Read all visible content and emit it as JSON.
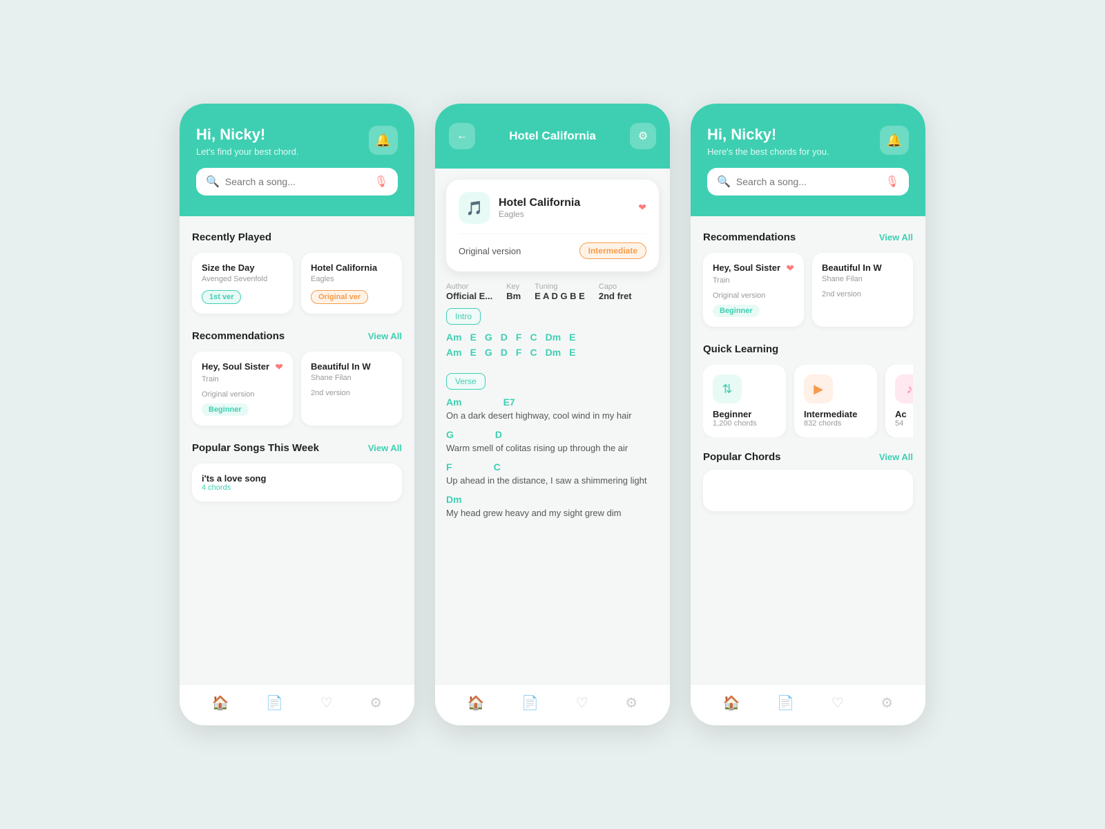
{
  "screen1": {
    "header": {
      "greeting": "Hi, Nicky!",
      "subtitle": "Let's find your best chord.",
      "notif_icon": "🔔"
    },
    "search": {
      "placeholder": "Search a song..."
    },
    "recently_played": {
      "title": "Recently Played",
      "songs": [
        {
          "name": "Size the Day",
          "artist": "Avenged Sevenfold",
          "badge": "1st ver",
          "badge_type": "green"
        },
        {
          "name": "Hotel California",
          "artist": "Eagles",
          "badge": "Original ver",
          "badge_type": "orange"
        }
      ]
    },
    "recommendations": {
      "title": "Recommendations",
      "view_all": "View All",
      "songs": [
        {
          "name": "Hey, Soul Sister",
          "artist": "Train",
          "version": "Original version",
          "badge": "Beginner",
          "has_heart": true
        },
        {
          "name": "Beautiful In W",
          "artist": "Shane Filan",
          "version": "2nd version",
          "badge": "",
          "has_heart": false
        }
      ]
    },
    "popular_songs": {
      "title": "Popular Songs This Week",
      "view_all": "View All",
      "songs": [
        {
          "name": "i'ts a love song",
          "chord_count": "4 chords"
        }
      ]
    },
    "nav": {
      "items": [
        {
          "icon": "🏠",
          "active": true
        },
        {
          "icon": "📄",
          "active": false
        },
        {
          "icon": "♡",
          "active": false
        },
        {
          "icon": "⚙",
          "active": false
        }
      ]
    }
  },
  "screen2": {
    "header": {
      "title": "Hotel California",
      "back_icon": "←",
      "settings_icon": "⚙"
    },
    "song_card": {
      "title": "Hotel California",
      "artist": "Eagles",
      "version": "Original version",
      "difficulty": "Intermediate",
      "has_heart": true
    },
    "metadata": [
      {
        "label": "Author",
        "value": "Official E..."
      },
      {
        "label": "Key",
        "value": "Bm"
      },
      {
        "label": "Tuning",
        "value": "E A D G B E"
      },
      {
        "label": "Capo",
        "value": "2nd fret"
      }
    ],
    "sections": [
      {
        "tag": "Intro",
        "chord_lines": [
          [
            "Am",
            "E",
            "G",
            "D",
            "F",
            "C",
            "Dm",
            "E"
          ],
          [
            "Am",
            "E",
            "G",
            "D",
            "F",
            "C",
            "Dm",
            "E"
          ]
        ]
      },
      {
        "tag": "Verse",
        "verses": [
          {
            "chords": [
              "Am",
              "E7"
            ],
            "lyric": "On a dark desert highway, cool wind in my hair"
          },
          {
            "chords": [
              "G",
              "D"
            ],
            "lyric": "Warm smell of colitas rising up through the air"
          },
          {
            "chords": [
              "F",
              "C"
            ],
            "lyric": "Up ahead in the distance, I saw a shimmering light"
          },
          {
            "chords": [
              "Dm"
            ],
            "lyric": "My head grew heavy and my sight grew dim"
          }
        ]
      }
    ],
    "nav": {
      "items": [
        {
          "icon": "🏠",
          "active": true
        },
        {
          "icon": "📄",
          "active": false
        },
        {
          "icon": "♡",
          "active": false
        },
        {
          "icon": "⚙",
          "active": false
        }
      ]
    }
  },
  "screen3": {
    "header": {
      "greeting": "Hi, Nicky!",
      "subtitle": "Here's the best chords for you.",
      "notif_icon": "🔔"
    },
    "search": {
      "placeholder": "Search a song..."
    },
    "recommendations": {
      "title": "Recommendations",
      "view_all": "View All",
      "songs": [
        {
          "name": "Hey, Soul Sister",
          "artist": "Train",
          "version": "Original version",
          "badge": "Beginner",
          "has_heart": true
        },
        {
          "name": "Beautiful In W",
          "artist": "Shane Filan",
          "version": "2nd version",
          "badge": "",
          "has_heart": false
        }
      ]
    },
    "quick_learning": {
      "title": "Quick Learning",
      "levels": [
        {
          "name": "Beginner",
          "chords": "1,200 chords",
          "icon": "⬆⬇",
          "color": "green"
        },
        {
          "name": "Intermediate",
          "chords": "832 chords",
          "icon": "▶",
          "color": "orange"
        },
        {
          "name": "Ac",
          "chords": "54",
          "icon": "♪",
          "color": "pink"
        }
      ]
    },
    "popular_chords": {
      "title": "Popular Chords",
      "view_all": "View All"
    },
    "nav": {
      "items": [
        {
          "icon": "🏠",
          "active": true
        },
        {
          "icon": "📄",
          "active": false
        },
        {
          "icon": "♡",
          "active": false
        },
        {
          "icon": "⚙",
          "active": false
        }
      ]
    }
  }
}
